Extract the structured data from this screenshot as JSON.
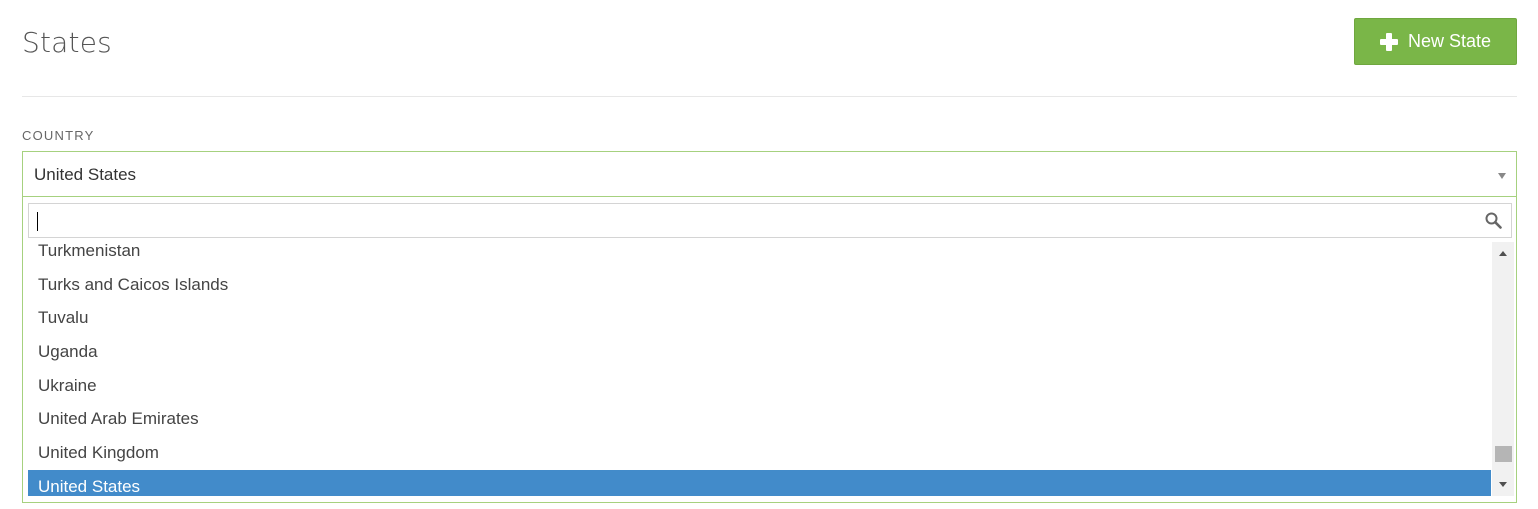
{
  "header": {
    "title": "States",
    "new_button_label": "New State",
    "new_button_icon": "plus-icon",
    "accent_color": "#7ab648"
  },
  "country_field": {
    "label": "COUNTRY",
    "selected_value": "United States",
    "search": {
      "value": "",
      "placeholder": "",
      "icon": "search-icon"
    },
    "options": [
      {
        "label": "Turkmenistan",
        "selected": false
      },
      {
        "label": "Turks and Caicos Islands",
        "selected": false
      },
      {
        "label": "Tuvalu",
        "selected": false
      },
      {
        "label": "Uganda",
        "selected": false
      },
      {
        "label": "Ukraine",
        "selected": false
      },
      {
        "label": "United Arab Emirates",
        "selected": false
      },
      {
        "label": "United Kingdom",
        "selected": false
      },
      {
        "label": "United States",
        "selected": true
      }
    ],
    "highlight_color": "#428bca",
    "border_color": "#a6d17f"
  }
}
